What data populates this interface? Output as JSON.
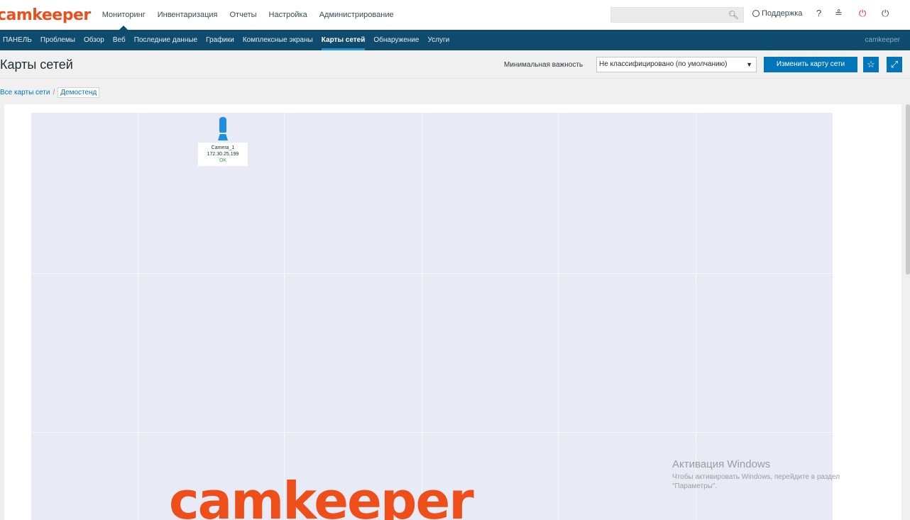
{
  "brand": {
    "logo_text": "camkeeper",
    "logo_color": "#e9501e"
  },
  "topnav": {
    "items": [
      "Мониторинг",
      "Инвентаризация",
      "Отчеты",
      "Настройка",
      "Администрирование"
    ],
    "active": "Мониторинг"
  },
  "topbar": {
    "search_placeholder": "",
    "support_label": "Поддержка",
    "help_glyph": "?",
    "user_glyph": "≗",
    "power_glyph": "⏻",
    "logout_glyph": "⏻"
  },
  "subnav": {
    "items": [
      "ПАНЕЛЬ",
      "Проблемы",
      "Обзор",
      "Веб",
      "Последние данные",
      "Графики",
      "Комплексные экраны",
      "Карты сетей",
      "Обнаружение",
      "Услуги"
    ],
    "active": "Карты сетей",
    "user": "camkeeper"
  },
  "header": {
    "title": "Карты сетей",
    "min_severity_label": "Минимальная важность",
    "min_severity_value": "Не классифицировано (по умолчанию)",
    "edit_button": "Изменить карту сети"
  },
  "breadcrumb": {
    "all_maps": "Все карты сети",
    "separator": "/",
    "current": "Демостенд"
  },
  "map": {
    "background": "#e8ebf5",
    "node": {
      "name": "Camera_1",
      "ip": "172.30.25.199",
      "status": "OK",
      "icon": "camera-icon"
    },
    "watermark_text": "camkeeper"
  },
  "os_overlay": {
    "title": "Активация Windows",
    "line1": "Чтобы активировать Windows, перейдите в раздел",
    "line2": "\"Параметры\"."
  },
  "colors": {
    "navy": "#0e4b6d",
    "accent_blue": "#0275b8",
    "ok_green": "#3ba03b",
    "brand_orange": "#e9501e"
  }
}
